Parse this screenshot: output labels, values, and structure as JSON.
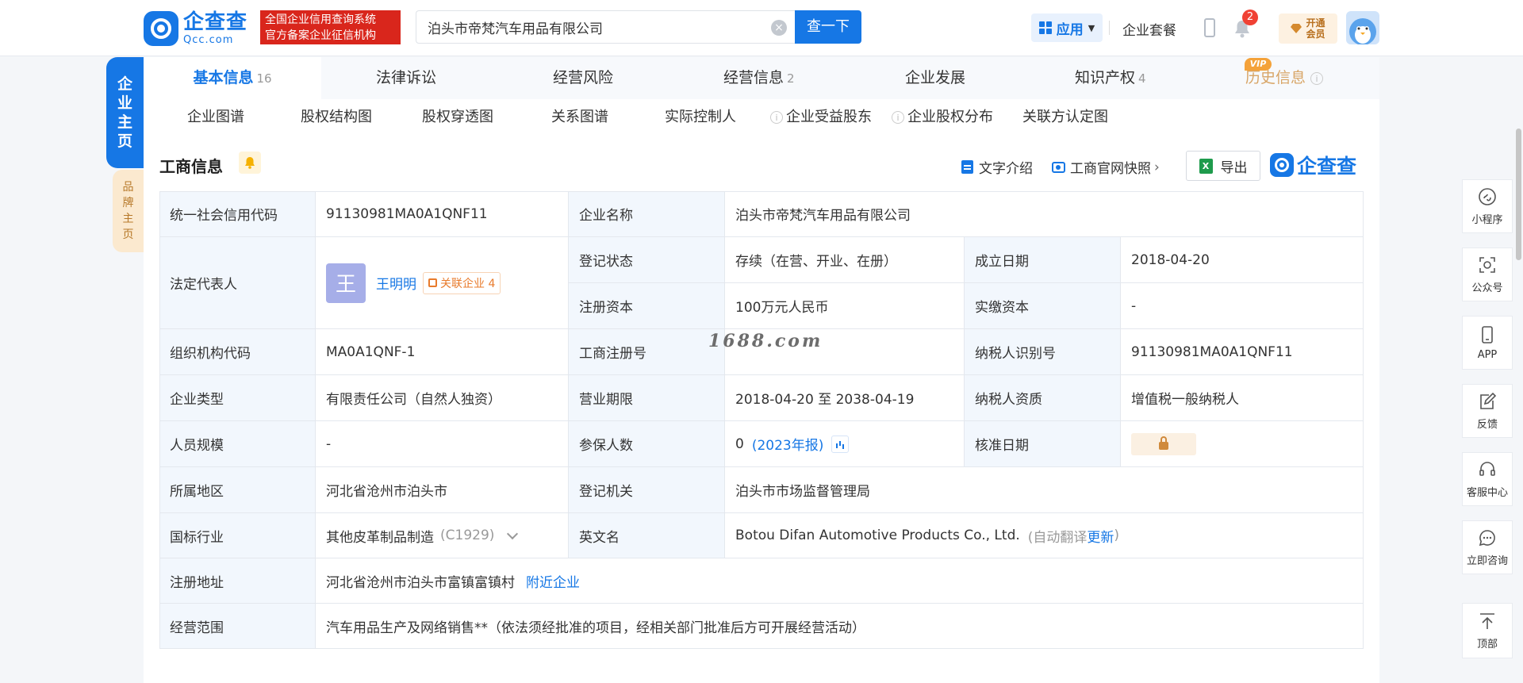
{
  "header": {
    "logo_cn": "企查查",
    "logo_en": "Qcc.com",
    "badge_line1": "全国企业信用查询系统",
    "badge_line2": "官方备案企业征信机构",
    "search_value": "泊头市帝梵汽车用品有限公司",
    "search_button": "查一下",
    "apps_label": "应用",
    "package_link": "企业套餐",
    "notification_count": "2",
    "vip_line1": "开通",
    "vip_line2": "会员"
  },
  "side_tabs": {
    "main": [
      "企",
      "业",
      "主",
      "页"
    ],
    "brand": [
      "品",
      "牌",
      "主",
      "页"
    ]
  },
  "tabs": [
    {
      "label": "基本信息",
      "count": "16"
    },
    {
      "label": "法律诉讼",
      "count": ""
    },
    {
      "label": "经营风险",
      "count": ""
    },
    {
      "label": "经营信息",
      "count": "2"
    },
    {
      "label": "企业发展",
      "count": ""
    },
    {
      "label": "知识产权",
      "count": "4"
    },
    {
      "label": "历史信息",
      "count": ""
    }
  ],
  "vip_tag": "VIP",
  "subtabs": [
    "企业图谱",
    "股权结构图",
    "股权穿透图",
    "关系图谱",
    "实际控制人",
    "企业受益股东",
    "企业股权分布",
    "关联方认定图"
  ],
  "section": {
    "title": "工商信息",
    "text_intro": "文字介绍",
    "snapshot": "工商官网快照",
    "export": "导出",
    "brand": "企查查"
  },
  "info": {
    "credit_code_label": "统一社会信用代码",
    "credit_code": "91130981MA0A1QNF11",
    "name_label": "企业名称",
    "name": "泊头市帝梵汽车用品有限公司",
    "rep_label": "法定代表人",
    "rep_avatar": "王",
    "rep_name": "王明明",
    "rep_related": "关联企业 4",
    "status_label": "登记状态",
    "status": "存续（在营、开业、在册）",
    "found_label": "成立日期",
    "found": "2018-04-20",
    "capital_label": "注册资本",
    "capital": "100万元人民币",
    "paid_label": "实缴资本",
    "paid": "-",
    "org_code_label": "组织机构代码",
    "org_code": "MA0A1QNF-1",
    "reg_no_label": "工商注册号",
    "reg_no": "",
    "tax_id_label": "纳税人识别号",
    "tax_id": "91130981MA0A1QNF11",
    "type_label": "企业类型",
    "type": "有限责任公司（自然人独资）",
    "term_label": "营业期限",
    "term": "2018-04-20 至 2038-04-19",
    "tax_qual_label": "纳税人资质",
    "tax_qual": "增值税一般纳税人",
    "staff_label": "人员规模",
    "staff": "-",
    "insured_label": "参保人数",
    "insured": "0",
    "insured_year": "(2023年报)",
    "approve_label": "核准日期",
    "region_label": "所属地区",
    "region": "河北省沧州市泊头市",
    "authority_label": "登记机关",
    "authority": "泊头市市场监督管理局",
    "industry_label": "国标行业",
    "industry": "其他皮革制品制造",
    "industry_code": "(C1929)",
    "en_name_label": "英文名",
    "en_name": "Botou Difan Automotive Products Co., Ltd.",
    "en_auto": "(自动翻译",
    "en_update": "更新",
    "en_close": ")",
    "address_label": "注册地址",
    "address": "河北省沧州市泊头市富镇富镇村",
    "nearby": "附近企业",
    "scope_label": "经营范围",
    "scope": "汽车用品生产及网络销售**（依法须经批准的项目，经相关部门批准后方可开展经营活动）"
  },
  "watermark": "1688.com",
  "right_toolbar": [
    "小程序",
    "公众号",
    "APP",
    "反馈",
    "客服中心",
    "立即咨询",
    "顶部"
  ]
}
